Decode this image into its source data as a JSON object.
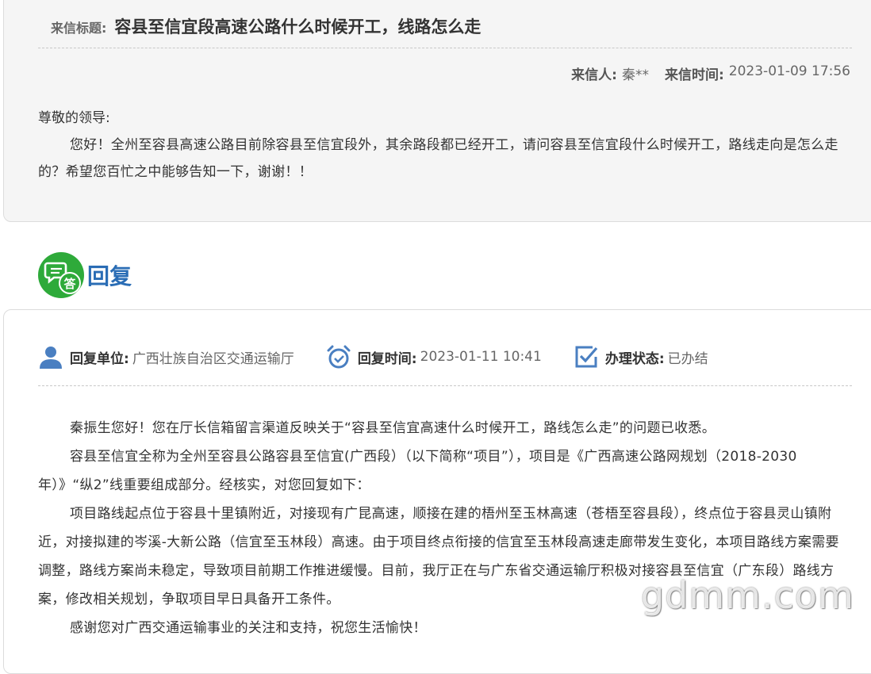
{
  "letter": {
    "title_label": "来信标题:",
    "title": "容县至信宜段高速公路什么时候开工，线路怎么走",
    "sender_label": "来信人:",
    "sender": "秦**",
    "time_label": "来信时间:",
    "time": "2023-01-09 17:56",
    "greeting": "尊敬的领导:",
    "body": "您好！全州至容县高速公路目前除容县至信宜段外，其余路段都已经开工，请问容县至信宜段什么时候开工，路线走向是怎么走的？希望您百忙之中能够告知一下，谢谢！！"
  },
  "reply": {
    "heading": "回复",
    "icon_char": "答",
    "unit_label": "回复单位:",
    "unit": "广西壮族自治区交通运输厅",
    "time_label": "回复时间:",
    "time": "2023-01-11 10:41",
    "status_label": "办理状态:",
    "status": "已办结",
    "paragraphs": [
      "秦振生您好！您在厅长信箱留言渠道反映关于“容县至信宜高速什么时候开工，路线怎么走”的问题已收悉。",
      "容县至信宜全称为全州至容县公路容县至信宜(广西段）（以下简称“项目”），项目是《广西高速公路网规划（2018-2030年）》“纵2”线重要组成部分。经核实，对您回复如下：",
      "项目路线起点位于容县十里镇附近，对接现有广昆高速，顺接在建的梧州至玉林高速（苍梧至容县段），终点位于容县灵山镇附近，对接拟建的岑溪-大新公路（信宜至玉林段）高速。由于项目终点衔接的信宜至玉林段高速走廊带发生变化，本项目路线方案需要调整，路线方案尚未稳定，导致项目前期工作推进缓慢。目前，我厅正在与广东省交通运输厅积极对接容县至信宜（广东段）路线方案，修改相关规划，争取项目早日具备开工条件。",
      "感谢您对广西交通运输事业的关注和支持，祝您生活愉快！"
    ]
  },
  "watermark": "gdmm.com",
  "colors": {
    "accent_blue": "#2a6db5",
    "icon_green": "#2eaa3a",
    "icon_blue": "#4a7fc1"
  },
  "icons": {
    "reply": "chat-answer-icon",
    "unit": "user-icon",
    "time": "alarm-clock-icon",
    "status": "checkbox-icon"
  }
}
